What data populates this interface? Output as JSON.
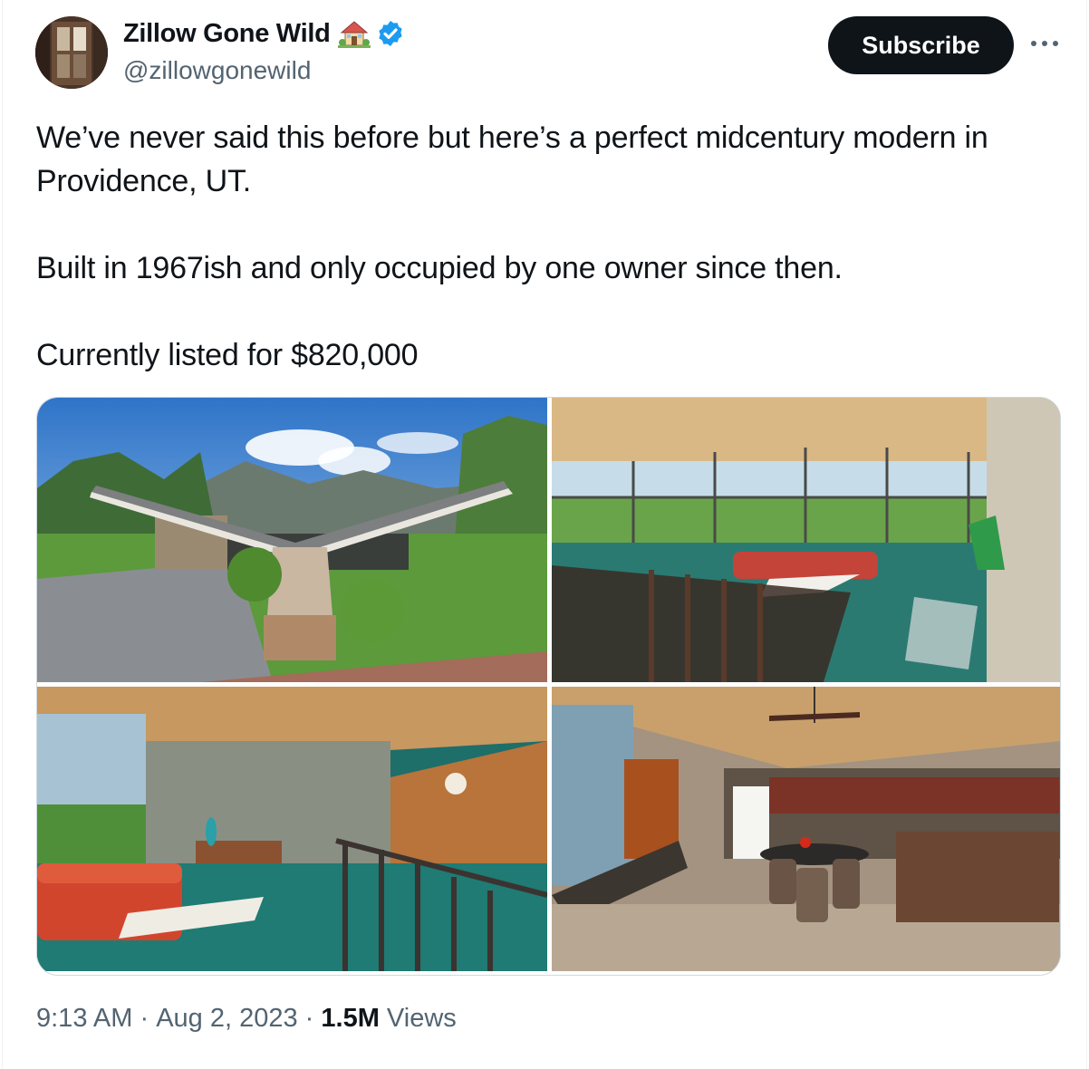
{
  "author": {
    "display_name": "Zillow Gone Wild",
    "handle": "@zillowgonewild",
    "emoji_icon": "house-with-garden-emoji",
    "verified_icon": "verified-badge-icon",
    "verified_color": "#1d9bf0"
  },
  "actions": {
    "subscribe_label": "Subscribe",
    "more_icon": "more-dots-icon"
  },
  "tweet": {
    "paragraphs": [
      "We’ve never said this before but here’s a perfect midcentury modern in Providence, UT.",
      "Built in 1967ish and only occupied by one owner since then.",
      "Currently listed for $820,000"
    ]
  },
  "media": {
    "photos": [
      "exterior-butterfly-roof-photo",
      "living-room-glass-walls-photo",
      "living-room-orange-sofa-photo",
      "kitchen-dining-photo"
    ]
  },
  "meta": {
    "time": "9:13 AM",
    "separator": " · ",
    "date": "Aug 2, 2023",
    "views_count": "1.5M",
    "views_label": " Views"
  },
  "colors": {
    "text": "#0f1419",
    "secondary": "#536471",
    "button_bg": "#0f1419",
    "border": "#cfd9de"
  }
}
